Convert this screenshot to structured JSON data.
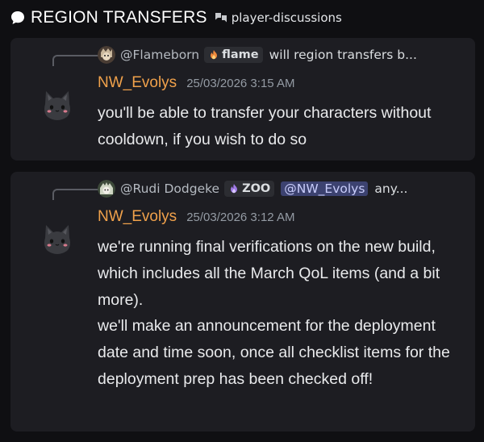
{
  "thread": {
    "title": "REGION TRANSFERS",
    "channel": "player-discussions"
  },
  "messages": [
    {
      "reply": {
        "author": "@Flameborn",
        "tag": "flame",
        "tag_icon": "flame-icon",
        "mention": "",
        "preview": "will region transfers b..."
      },
      "author": "NW_Evolys",
      "timestamp": "25/03/2026 3:15 AM",
      "lines": [
        "you'll be able to transfer your characters without cooldown, if you wish to do so"
      ]
    },
    {
      "reply": {
        "author": "@Rudi  Dodgeke",
        "tag": "ZOO",
        "tag_icon": "purple-flame-icon",
        "mention": "@NW_Evolys",
        "preview": "any..."
      },
      "author": "NW_Evolys",
      "timestamp": "25/03/2026 3:12 AM",
      "lines": [
        "we're running final verifications on the new build, which includes all the March QoL items (and a bit more).",
        "we'll make an announcement for the deployment date and time soon, once all checklist items for the deployment prep has been checked off!"
      ]
    }
  ],
  "colors": {
    "author": "#f0a14b",
    "timestamp": "#949ba4",
    "mention_bg": "#3c4270",
    "card_bg": "#1d1d22"
  }
}
